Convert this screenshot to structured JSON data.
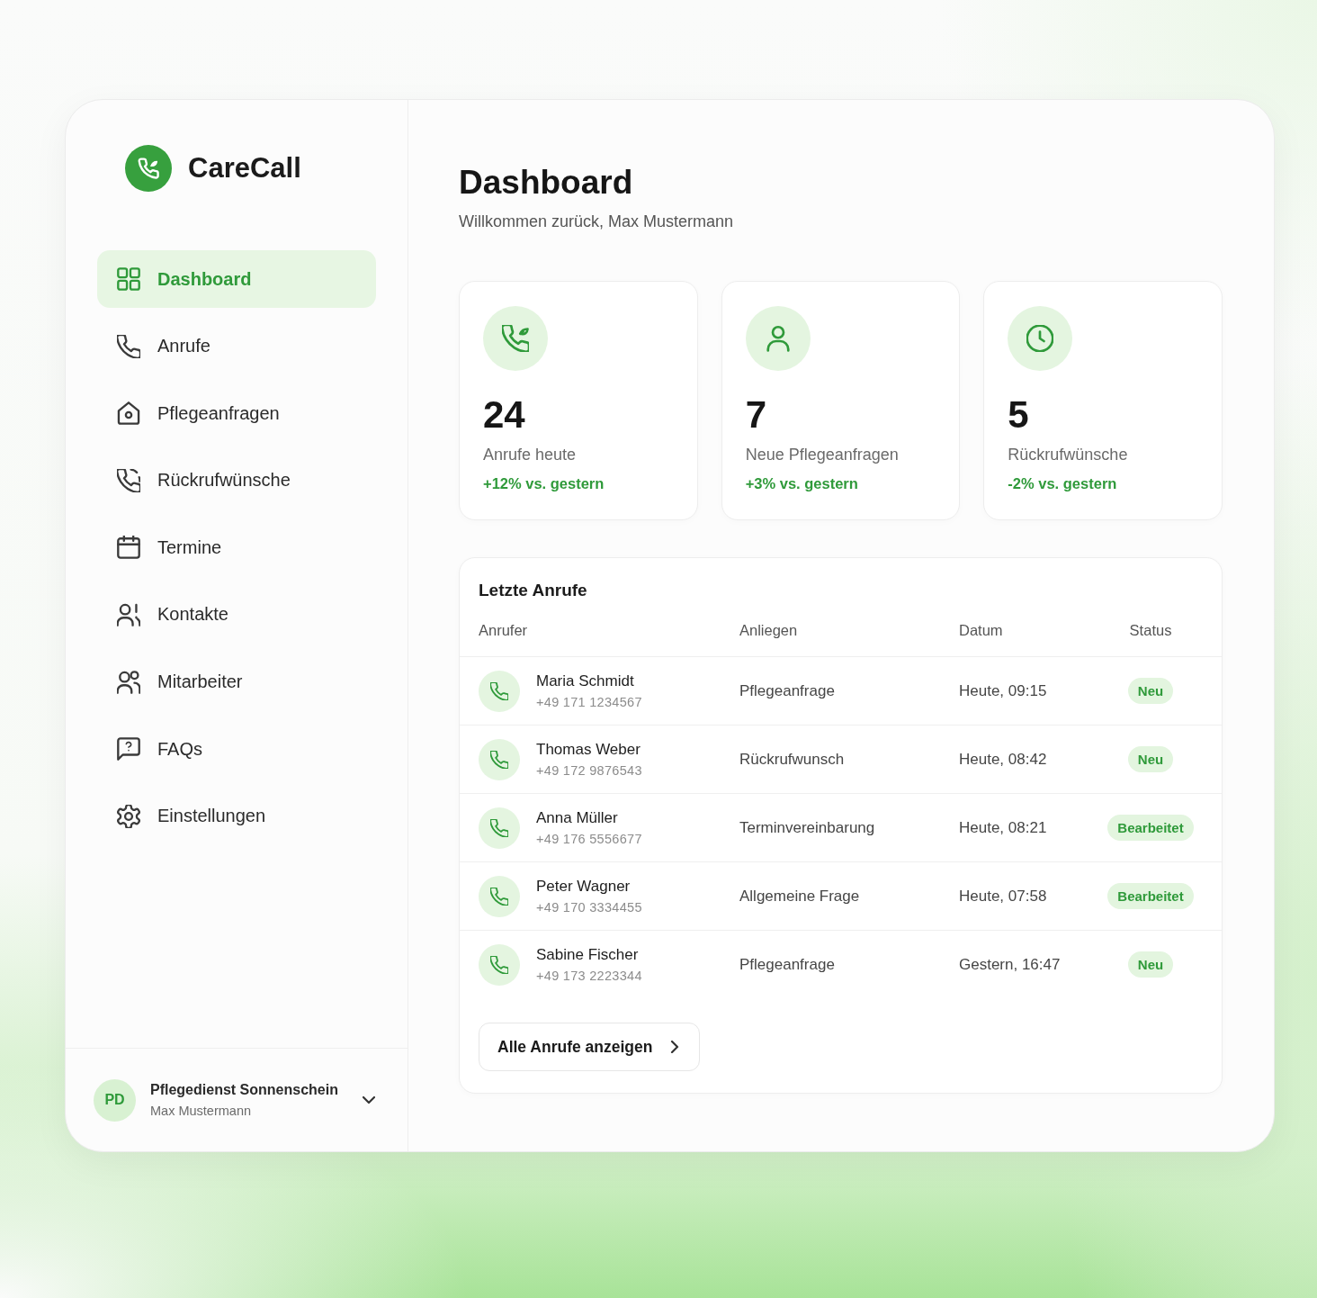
{
  "sidebar": {
    "brand": "CareCall",
    "nav_items": [
      {
        "label": "Dashboard",
        "selected": true
      },
      {
        "label": "Anrufe",
        "selected": false
      },
      {
        "label": "Pflegeanfragen",
        "selected": false
      },
      {
        "label": "Rückrufwünsche",
        "selected": false
      },
      {
        "label": "Termine",
        "selected": false
      },
      {
        "label": "Kontakte",
        "selected": false
      },
      {
        "label": "Mitarbeiter",
        "selected": false
      },
      {
        "label": "FAQs",
        "selected": false
      },
      {
        "label": "Einstellungen",
        "selected": false
      }
    ],
    "account": {
      "initials": "PD",
      "name": "Pflegedienst Sonnenschein",
      "user": "Max Mustermann"
    }
  },
  "header": {
    "title": "Dashboard",
    "subtitle": "Willkommen zurück, Max Mustermann"
  },
  "stats": [
    {
      "value": "24",
      "label": "Anrufe heute",
      "change": "+12% vs. gestern"
    },
    {
      "value": "7",
      "label": "Neue Pflegeanfragen",
      "change": "+3% vs. gestern"
    },
    {
      "value": "5",
      "label": "Rückrufwünsche",
      "change": "-2% vs. gestern"
    }
  ],
  "recent_calls": {
    "title": "Letzte Anrufe",
    "columns": [
      "Anrufer",
      "Anliegen",
      "Datum",
      "Status"
    ],
    "rows": [
      {
        "caller": "Maria Schmidt",
        "phone": "+49 171 1234567",
        "concern": "Pflegeanfrage",
        "date": "Heute, 09:15",
        "status": "Neu"
      },
      {
        "caller": "Thomas Weber",
        "phone": "+49 172 9876543",
        "concern": "Rückrufwunsch",
        "date": "Heute, 08:42",
        "status": "Neu"
      },
      {
        "caller": "Anna Müller",
        "phone": "+49 176 5556677",
        "concern": "Terminvereinbarung",
        "date": "Heute, 08:21",
        "status": "Bearbeitet"
      },
      {
        "caller": "Peter Wagner",
        "phone": "+49 170 3334455",
        "concern": "Allgemeine Frage",
        "date": "Heute, 07:58",
        "status": "Bearbeitet"
      },
      {
        "caller": "Sabine Fischer",
        "phone": "+49 173 2223344",
        "concern": "Pflegeanfrage",
        "date": "Gestern, 16:47",
        "status": "Neu"
      }
    ],
    "show_all": "Alle Anrufe anzeigen"
  }
}
